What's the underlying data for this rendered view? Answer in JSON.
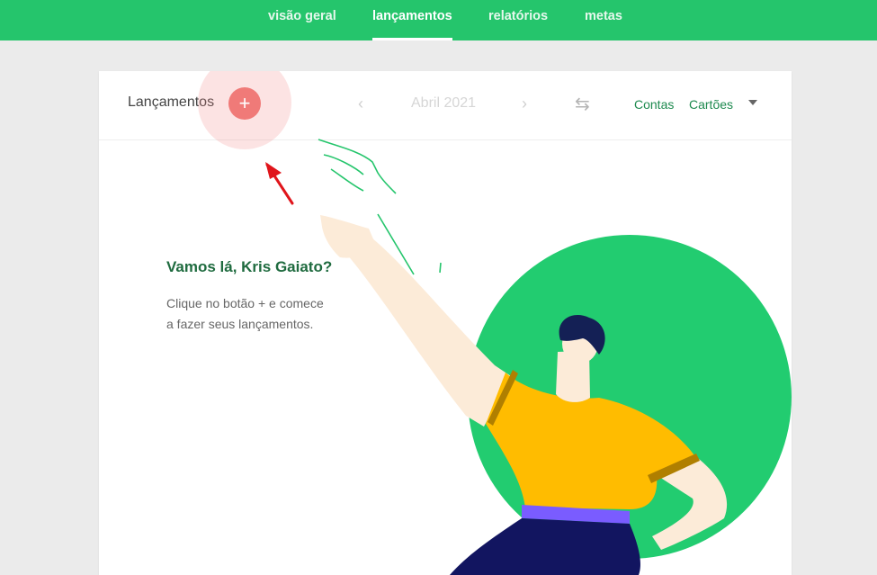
{
  "nav": {
    "tabs": [
      {
        "label": "visão geral"
      },
      {
        "label": "lançamentos"
      },
      {
        "label": "relatórios"
      },
      {
        "label": "metas"
      }
    ]
  },
  "header": {
    "title": "Lançamentos",
    "add_button": "+",
    "month": "Abril 2021",
    "prev_icon": "‹",
    "next_icon": "›",
    "swap_icon": "⇆",
    "filters": [
      "Contas",
      "Cartões"
    ]
  },
  "empty_state": {
    "heading": "Vamos lá, Kris Gaiato?",
    "line1": "Clique no botão + e comece",
    "line2": "a fazer seus lançamentos."
  },
  "colors": {
    "brand_green": "#25c56c",
    "accent_red": "#f07a78",
    "heading_green": "#1f6b3f"
  },
  "icons": {
    "add": "plus-icon",
    "prev": "chevron-left-icon",
    "next": "chevron-right-icon",
    "swap": "swap-arrows-icon",
    "dropdown": "caret-down-icon",
    "annotation": "red-arrow-icon"
  }
}
